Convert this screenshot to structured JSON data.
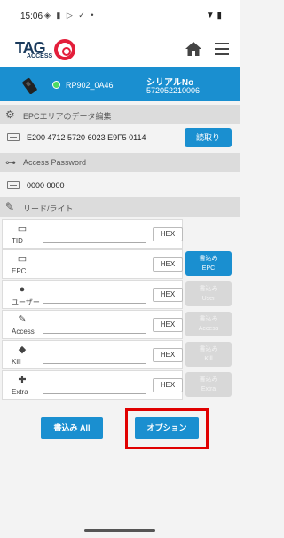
{
  "status_bar": {
    "time": "15:06",
    "icons": "◈ ▮ ▷ ✓ •",
    "right": "▼ ▮"
  },
  "app": {
    "logo_tag": "TAG",
    "logo_access": "ACCESS"
  },
  "device": {
    "name": "RP902_0A46",
    "serial_label": "シリアルNo",
    "serial": "572052210006"
  },
  "epc_section": {
    "title": "EPCエリアのデータ編集",
    "epc_value": "E200 4712 5720 6023 E9F5 0114",
    "read_label": "読取り"
  },
  "password_section": {
    "title": "Access Password",
    "value": "0000 0000"
  },
  "rw_section": {
    "title": "リード/ライト"
  },
  "tag_rows": [
    {
      "label": "TID",
      "hex": "HEX"
    },
    {
      "label": "EPC",
      "hex": "HEX",
      "write": "書込み\nEPC"
    },
    {
      "label": "ユーザー",
      "hex": "HEX",
      "write": "書込み\nUser"
    },
    {
      "label": "Access",
      "hex": "HEX",
      "write": "書込み\nAccess"
    },
    {
      "label": "Kill",
      "hex": "HEX",
      "write": "書込み\nKill"
    },
    {
      "label": "Extra",
      "hex": "HEX",
      "write": "書込み\nExtra"
    }
  ],
  "buttons": {
    "write_all": "書込み All",
    "options": "オプション"
  },
  "colors": {
    "accent": "#1a8fd0",
    "highlight": "#e00000",
    "status_ok": "#4cd964"
  }
}
